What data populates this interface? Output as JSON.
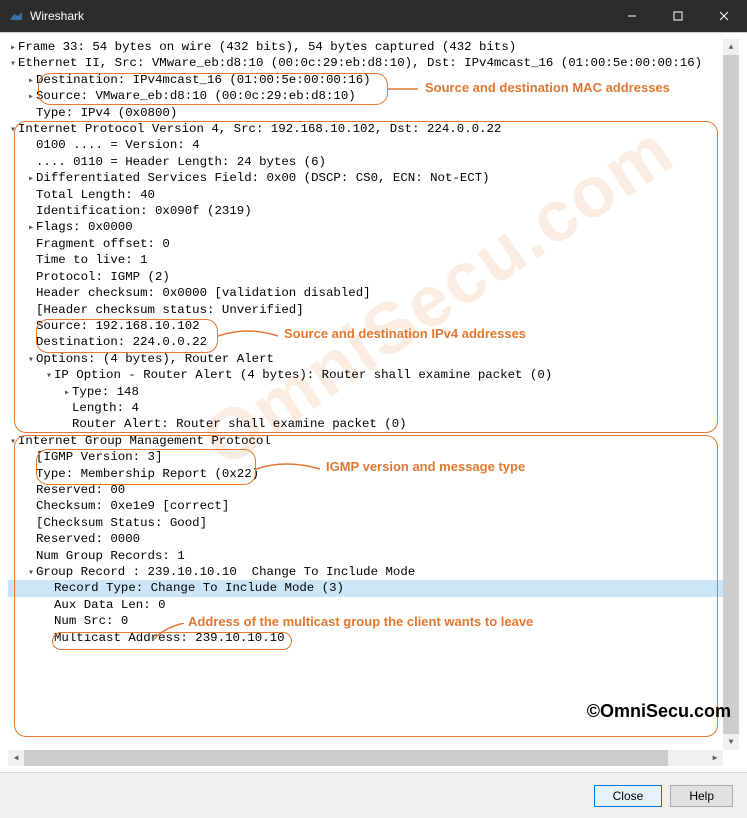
{
  "window": {
    "title": "Wireshark"
  },
  "lines": [
    {
      "indent": 0,
      "arrow": ">",
      "text": "Frame 33: 54 bytes on wire (432 bits), 54 bytes captured (432 bits)",
      "interactable": true
    },
    {
      "indent": 0,
      "arrow": "v",
      "text": "Ethernet II, Src: VMware_eb:d8:10 (00:0c:29:eb:d8:10), Dst: IPv4mcast_16 (01:00:5e:00:00:16)",
      "interactable": true
    },
    {
      "indent": 1,
      "arrow": ">",
      "text": "Destination: IPv4mcast_16 (01:00:5e:00:00:16)",
      "interactable": true
    },
    {
      "indent": 1,
      "arrow": ">",
      "text": "Source: VMware_eb:d8:10 (00:0c:29:eb:d8:10)",
      "interactable": true
    },
    {
      "indent": 1,
      "arrow": "",
      "text": "Type: IPv4 (0x0800)",
      "interactable": true
    },
    {
      "indent": 0,
      "arrow": "v",
      "text": "Internet Protocol Version 4, Src: 192.168.10.102, Dst: 224.0.0.22",
      "interactable": true
    },
    {
      "indent": 1,
      "arrow": "",
      "text": "0100 .... = Version: 4",
      "interactable": true
    },
    {
      "indent": 1,
      "arrow": "",
      "text": ".... 0110 = Header Length: 24 bytes (6)",
      "interactable": true
    },
    {
      "indent": 1,
      "arrow": ">",
      "text": "Differentiated Services Field: 0x00 (DSCP: CS0, ECN: Not-ECT)",
      "interactable": true
    },
    {
      "indent": 1,
      "arrow": "",
      "text": "Total Length: 40",
      "interactable": true
    },
    {
      "indent": 1,
      "arrow": "",
      "text": "Identification: 0x090f (2319)",
      "interactable": true
    },
    {
      "indent": 1,
      "arrow": ">",
      "text": "Flags: 0x0000",
      "interactable": true
    },
    {
      "indent": 1,
      "arrow": "",
      "text": "Fragment offset: 0",
      "interactable": true
    },
    {
      "indent": 1,
      "arrow": "",
      "text": "Time to live: 1",
      "interactable": true
    },
    {
      "indent": 1,
      "arrow": "",
      "text": "Protocol: IGMP (2)",
      "interactable": true
    },
    {
      "indent": 1,
      "arrow": "",
      "text": "Header checksum: 0x0000 [validation disabled]",
      "interactable": true
    },
    {
      "indent": 1,
      "arrow": "",
      "text": "[Header checksum status: Unverified]",
      "interactable": true
    },
    {
      "indent": 1,
      "arrow": "",
      "text": "Source: 192.168.10.102",
      "interactable": true
    },
    {
      "indent": 1,
      "arrow": "",
      "text": "Destination: 224.0.0.22",
      "interactable": true
    },
    {
      "indent": 1,
      "arrow": "v",
      "text": "Options: (4 bytes), Router Alert",
      "interactable": true
    },
    {
      "indent": 2,
      "arrow": "v",
      "text": "IP Option - Router Alert (4 bytes): Router shall examine packet (0)",
      "interactable": true
    },
    {
      "indent": 3,
      "arrow": ">",
      "text": "Type: 148",
      "interactable": true
    },
    {
      "indent": 3,
      "arrow": "",
      "text": "Length: 4",
      "interactable": true
    },
    {
      "indent": 3,
      "arrow": "",
      "text": "Router Alert: Router shall examine packet (0)",
      "interactable": true
    },
    {
      "indent": 0,
      "arrow": "v",
      "text": "Internet Group Management Protocol",
      "interactable": true
    },
    {
      "indent": 1,
      "arrow": "",
      "text": "[IGMP Version: 3]",
      "interactable": true
    },
    {
      "indent": 1,
      "arrow": "",
      "text": "Type: Membership Report (0x22)",
      "interactable": true
    },
    {
      "indent": 1,
      "arrow": "",
      "text": "Reserved: 00",
      "interactable": true
    },
    {
      "indent": 1,
      "arrow": "",
      "text": "Checksum: 0xe1e9 [correct]",
      "interactable": true
    },
    {
      "indent": 1,
      "arrow": "",
      "text": "[Checksum Status: Good]",
      "interactable": true
    },
    {
      "indent": 1,
      "arrow": "",
      "text": "Reserved: 0000",
      "interactable": true
    },
    {
      "indent": 1,
      "arrow": "",
      "text": "Num Group Records: 1",
      "interactable": true
    },
    {
      "indent": 1,
      "arrow": "v",
      "text": "Group Record : 239.10.10.10  Change To Include Mode",
      "interactable": true
    },
    {
      "indent": 2,
      "arrow": "",
      "text": "Record Type: Change To Include Mode (3)",
      "interactable": true,
      "highlight": true
    },
    {
      "indent": 2,
      "arrow": "",
      "text": "Aux Data Len: 0",
      "interactable": true
    },
    {
      "indent": 2,
      "arrow": "",
      "text": "Num Src: 0",
      "interactable": true
    },
    {
      "indent": 2,
      "arrow": "",
      "text": "Multicast Address: 239.10.10.10",
      "interactable": true
    }
  ],
  "annotations": {
    "mac": "Source and destination MAC addresses",
    "ipv4": "Source and destination IPv4 addresses",
    "igmp": "IGMP version and message type",
    "mcast": "Address of the multicast group the client wants to leave"
  },
  "footer": {
    "close": "Close",
    "help": "Help"
  },
  "copyright": "©OmniSecu.com",
  "watermark": "OmniSecu.com"
}
